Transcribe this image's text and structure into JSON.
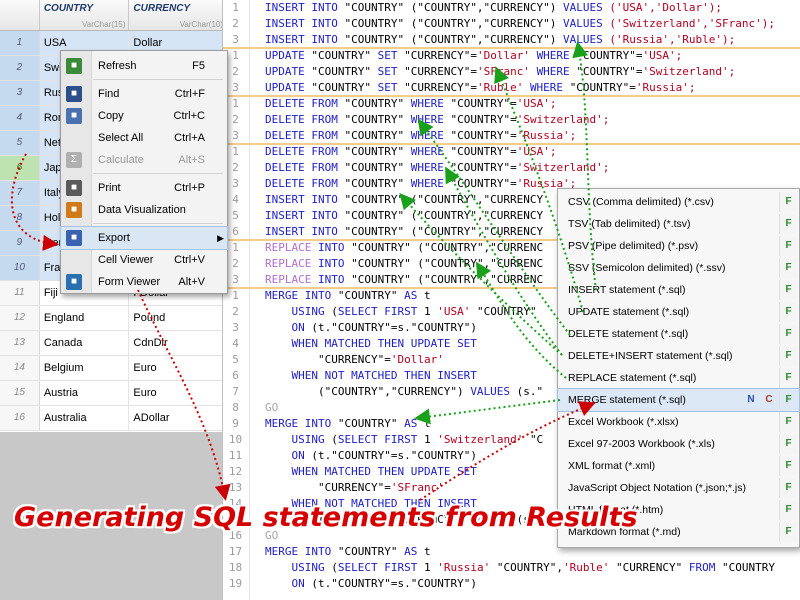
{
  "grid": {
    "columns": [
      {
        "name": "COUNTRY",
        "type": "VarChar(15)"
      },
      {
        "name": "CURRENCY",
        "type": "VarChar(10)"
      }
    ],
    "rows": [
      {
        "num": "1",
        "country": "USA",
        "currency": "Dollar"
      },
      {
        "num": "2",
        "country": "Swi",
        "currency": ""
      },
      {
        "num": "3",
        "country": "Rus",
        "currency": ""
      },
      {
        "num": "4",
        "country": "Ror",
        "currency": ""
      },
      {
        "num": "5",
        "country": "Net",
        "currency": ""
      },
      {
        "num": "6",
        "country": "Jap",
        "currency": ""
      },
      {
        "num": "7",
        "country": "Italy",
        "currency": ""
      },
      {
        "num": "8",
        "country": "Hol",
        "currency": ""
      },
      {
        "num": "9",
        "country": "Ger",
        "currency": ""
      },
      {
        "num": "10",
        "country": "Fra",
        "currency": ""
      },
      {
        "num": "11",
        "country": "Fiji",
        "currency": "FDollar"
      },
      {
        "num": "12",
        "country": "England",
        "currency": "Pound"
      },
      {
        "num": "13",
        "country": "Canada",
        "currency": "CdnDlr"
      },
      {
        "num": "14",
        "country": "Belgium",
        "currency": "Euro"
      },
      {
        "num": "15",
        "country": "Austria",
        "currency": "Euro"
      },
      {
        "num": "16",
        "country": "Australia",
        "currency": "ADollar"
      }
    ]
  },
  "context_menu": [
    {
      "label": "Refresh",
      "key": "F5",
      "icon": "refresh-icon",
      "color": "#3a8a3a"
    },
    {
      "label": "Find",
      "key": "Ctrl+F",
      "icon": "binoculars-icon",
      "color": "#2c4f8a"
    },
    {
      "label": "Copy",
      "key": "Ctrl+C",
      "icon": "copy-icon",
      "color": "#4a72b0"
    },
    {
      "label": "Select All",
      "key": "Ctrl+A",
      "icon": "",
      "color": ""
    },
    {
      "label": "Calculate",
      "key": "Alt+S",
      "icon": "sigma-icon",
      "color": "#b0b0b0",
      "disabled": true
    },
    {
      "label": "Print",
      "key": "Ctrl+P",
      "icon": "printer-icon",
      "color": "#5a5a5a"
    },
    {
      "label": "Data Visualization",
      "key": "",
      "icon": "chart-icon",
      "color": "#d07a1a"
    },
    {
      "label": "Export",
      "key": "",
      "icon": "export-icon",
      "color": "#3a62b0",
      "submenu": true
    },
    {
      "label": "Cell Viewer",
      "key": "Ctrl+V",
      "icon": "",
      "color": ""
    },
    {
      "label": "Form Viewer",
      "key": "Alt+V",
      "icon": "form-icon",
      "color": "#2a6fb0"
    }
  ],
  "export_menu": [
    {
      "label": "CSV (Comma delimited) (*.csv)",
      "badges": [
        "F"
      ]
    },
    {
      "label": "TSV (Tab delimited) (*.tsv)",
      "badges": [
        "F"
      ]
    },
    {
      "label": "PSV (Pipe delimited) (*.psv)",
      "badges": [
        "F"
      ]
    },
    {
      "label": "SSV (Semicolon delimited) (*.ssv)",
      "badges": [
        "F"
      ]
    },
    {
      "label": "INSERT statement (*.sql)",
      "badges": [
        "F"
      ]
    },
    {
      "label": "UPDATE statement (*.sql)",
      "badges": [
        "F"
      ]
    },
    {
      "label": "DELETE statement (*.sql)",
      "badges": [
        "F"
      ]
    },
    {
      "label": "DELETE+INSERT statement (*.sql)",
      "badges": [
        "F"
      ]
    },
    {
      "label": "REPLACE statement (*.sql)",
      "badges": [
        "F"
      ]
    },
    {
      "label": "MERGE statement (*.sql)",
      "badges": [
        "N",
        "C",
        "F"
      ],
      "active": true
    },
    {
      "label": "Excel Workbook (*.xlsx)",
      "badges": [
        "F"
      ]
    },
    {
      "label": "Excel 97-2003 Workbook (*.xls)",
      "badges": [
        "F"
      ]
    },
    {
      "label": "XML format (*.xml)",
      "badges": [
        "F"
      ]
    },
    {
      "label": "JavaScript Object Notation (*.json;*.js)",
      "badges": [
        "F"
      ]
    },
    {
      "label": "HTML format (*.htm)",
      "badges": [
        "F"
      ]
    },
    {
      "label": "Markdown format (*.md)",
      "badges": [
        "F"
      ]
    }
  ],
  "editor": {
    "lines": [
      {
        "n": "1",
        "t": [
          [
            "k",
            "INSERT INTO "
          ],
          [
            "p",
            "\"COUNTRY\" (\"COUNTRY\",\"CURRENCY\") "
          ],
          [
            "k",
            "VALUES "
          ],
          [
            "s",
            "('USA','Dollar');"
          ]
        ]
      },
      {
        "n": "2",
        "t": [
          [
            "k",
            "INSERT INTO "
          ],
          [
            "p",
            "\"COUNTRY\" (\"COUNTRY\",\"CURRENCY\") "
          ],
          [
            "k",
            "VALUES "
          ],
          [
            "s",
            "('Switzerland','SFranc');"
          ]
        ]
      },
      {
        "n": "3",
        "t": [
          [
            "k",
            "INSERT INTO "
          ],
          [
            "p",
            "\"COUNTRY\" (\"COUNTRY\",\"CURRENCY\") "
          ],
          [
            "k",
            "VALUES "
          ],
          [
            "s",
            "('Russia','Ruble');"
          ]
        ]
      },
      {
        "sep": true
      },
      {
        "n": "1",
        "t": [
          [
            "k",
            "UPDATE "
          ],
          [
            "p",
            "\"COUNTRY\" "
          ],
          [
            "k",
            "SET "
          ],
          [
            "p",
            "\"CURRENCY\"="
          ],
          [
            "s",
            "'Dollar' "
          ],
          [
            "k",
            "WHERE "
          ],
          [
            "p",
            "\"COUNTRY\"="
          ],
          [
            "s",
            "'USA';"
          ]
        ]
      },
      {
        "n": "2",
        "t": [
          [
            "k",
            "UPDATE "
          ],
          [
            "p",
            "\"COUNTRY\" "
          ],
          [
            "k",
            "SET "
          ],
          [
            "p",
            "\"CURRENCY\"="
          ],
          [
            "s",
            "'SFranc' "
          ],
          [
            "k",
            "WHERE "
          ],
          [
            "p",
            "\"COUNTRY\"="
          ],
          [
            "s",
            "'Switzerland';"
          ]
        ]
      },
      {
        "n": "3",
        "t": [
          [
            "k",
            "UPDATE "
          ],
          [
            "p",
            "\"COUNTRY\" "
          ],
          [
            "k",
            "SET "
          ],
          [
            "p",
            "\"CURRENCY\"="
          ],
          [
            "s",
            "'Ruble' "
          ],
          [
            "k",
            "WHERE "
          ],
          [
            "p",
            "\"COUNTRY\"="
          ],
          [
            "s",
            "'Russia';"
          ]
        ]
      },
      {
        "sep": true
      },
      {
        "n": "1",
        "t": [
          [
            "k",
            "DELETE FROM "
          ],
          [
            "p",
            "\"COUNTRY\" "
          ],
          [
            "k",
            "WHERE "
          ],
          [
            "p",
            "\"COUNTRY\"="
          ],
          [
            "s",
            "'USA';"
          ]
        ]
      },
      {
        "n": "2",
        "t": [
          [
            "k",
            "DELETE FROM "
          ],
          [
            "p",
            "\"COUNTRY\" "
          ],
          [
            "k",
            "WHERE "
          ],
          [
            "p",
            "\"COUNTRY\"="
          ],
          [
            "s",
            "'Switzerland';"
          ]
        ]
      },
      {
        "n": "3",
        "t": [
          [
            "k",
            "DELETE FROM "
          ],
          [
            "p",
            "\"COUNTRY\" "
          ],
          [
            "k",
            "WHERE "
          ],
          [
            "p",
            "\"COUNTRY\"="
          ],
          [
            "s",
            "'Russia';"
          ]
        ]
      },
      {
        "sep": true
      },
      {
        "n": "1",
        "t": [
          [
            "k",
            "DELETE FROM "
          ],
          [
            "p",
            "\"COUNTRY\" "
          ],
          [
            "k",
            "WHERE "
          ],
          [
            "p",
            "\"COUNTRY\"="
          ],
          [
            "s",
            "'USA';"
          ]
        ]
      },
      {
        "n": "2",
        "t": [
          [
            "k",
            "DELETE FROM "
          ],
          [
            "p",
            "\"COUNTRY\" "
          ],
          [
            "k",
            "WHERE "
          ],
          [
            "p",
            "\"COUNTRY\"="
          ],
          [
            "s",
            "'Switzerland';"
          ]
        ]
      },
      {
        "n": "3",
        "t": [
          [
            "k",
            "DELETE FROM "
          ],
          [
            "p",
            "\"COUNTRY\" "
          ],
          [
            "k",
            "WHERE "
          ],
          [
            "p",
            "\"COUNTRY\"="
          ],
          [
            "s",
            "'Russia';"
          ]
        ]
      },
      {
        "n": "4",
        "t": [
          [
            "k",
            "INSERT INTO "
          ],
          [
            "p",
            "\"COUNTRY\" (\"COUNTRY\",\"CURRENCY"
          ]
        ]
      },
      {
        "n": "5",
        "t": [
          [
            "k",
            "INSERT INTO "
          ],
          [
            "p",
            "\"COUNTRY\" (\"COUNTRY\",\"CURRENCY"
          ]
        ]
      },
      {
        "n": "6",
        "t": [
          [
            "k",
            "INSERT INTO "
          ],
          [
            "p",
            "\"COUNTRY\" (\"COUNTRY\",\"CURRENCY"
          ]
        ]
      },
      {
        "sep": true
      },
      {
        "n": "1",
        "t": [
          [
            "r",
            "REPLACE "
          ],
          [
            "k",
            "INTO "
          ],
          [
            "p",
            "\"COUNTRY\" (\"COUNTRY\",\"CURRENC"
          ]
        ]
      },
      {
        "n": "2",
        "t": [
          [
            "r",
            "REPLACE "
          ],
          [
            "k",
            "INTO "
          ],
          [
            "p",
            "\"COUNTRY\" (\"COUNTRY\",\"CURRENC"
          ]
        ]
      },
      {
        "n": "3",
        "t": [
          [
            "r",
            "REPLACE "
          ],
          [
            "k",
            "INTO "
          ],
          [
            "p",
            "\"COUNTRY\" (\"COUNTRY\",\"CURRENC"
          ]
        ]
      },
      {
        "sep": true
      },
      {
        "n": "1",
        "t": [
          [
            "k",
            "MERGE INTO "
          ],
          [
            "p",
            "\"COUNTRY\" "
          ],
          [
            "k",
            "AS "
          ],
          [
            "p",
            "t"
          ]
        ]
      },
      {
        "n": "2",
        "t": [
          [
            "p",
            "    "
          ],
          [
            "k",
            "USING "
          ],
          [
            "p",
            "("
          ],
          [
            "k",
            "SELECT FIRST "
          ],
          [
            "p",
            "1 "
          ],
          [
            "s",
            "'USA' "
          ],
          [
            "p",
            "\"COUNTRY\""
          ]
        ]
      },
      {
        "n": "3",
        "t": [
          [
            "p",
            "    "
          ],
          [
            "k",
            "ON "
          ],
          [
            "p",
            "(t.\"COUNTRY\"=s.\"COUNTRY\")"
          ]
        ]
      },
      {
        "n": "4",
        "t": [
          [
            "p",
            "    "
          ],
          [
            "k",
            "WHEN MATCHED THEN UPDATE SET"
          ]
        ]
      },
      {
        "n": "5",
        "t": [
          [
            "p",
            "        \"CURRENCY\"="
          ],
          [
            "s",
            "'Dollar'"
          ]
        ]
      },
      {
        "n": "6",
        "t": [
          [
            "p",
            "    "
          ],
          [
            "k",
            "WHEN NOT MATCHED THEN INSERT"
          ]
        ]
      },
      {
        "n": "7",
        "t": [
          [
            "p",
            "        (\"COUNTRY\",\"CURRENCY\") "
          ],
          [
            "k",
            "VALUES "
          ],
          [
            "p",
            "(s.\""
          ]
        ]
      },
      {
        "n": "8",
        "t": [
          [
            "g",
            "GO"
          ]
        ]
      },
      {
        "n": "9",
        "t": [
          [
            "k",
            "MERGE INTO "
          ],
          [
            "p",
            "\"COUNTRY\" "
          ],
          [
            "k",
            "AS "
          ],
          [
            "p",
            "t"
          ]
        ]
      },
      {
        "n": "10",
        "t": [
          [
            "p",
            "    "
          ],
          [
            "k",
            "USING "
          ],
          [
            "p",
            "("
          ],
          [
            "k",
            "SELECT FIRST "
          ],
          [
            "p",
            "1 "
          ],
          [
            "s",
            "'Switzerland' "
          ],
          [
            "p",
            "\"C"
          ]
        ]
      },
      {
        "n": "11",
        "t": [
          [
            "p",
            "    "
          ],
          [
            "k",
            "ON "
          ],
          [
            "p",
            "(t.\"COUNTRY\"=s.\"COUNTRY\")"
          ]
        ]
      },
      {
        "n": "12",
        "t": [
          [
            "p",
            "    "
          ],
          [
            "k",
            "WHEN MATCHED THEN UPDATE SET"
          ]
        ]
      },
      {
        "n": "13",
        "t": [
          [
            "p",
            "        \"CURRENCY\"="
          ],
          [
            "s",
            "'SFranc'"
          ]
        ]
      },
      {
        "n": "14",
        "t": [
          [
            "p",
            "    "
          ],
          [
            "k",
            "WHEN NOT MATCHED THEN INSERT"
          ]
        ]
      },
      {
        "n": "15",
        "t": [
          [
            "p",
            "        (\"COUNTRY\",\"CURRENCY\") "
          ],
          [
            "k",
            "VALUES "
          ],
          [
            "p",
            "(s.\""
          ]
        ]
      },
      {
        "n": "16",
        "t": [
          [
            "g",
            "GO"
          ]
        ]
      },
      {
        "n": "17",
        "t": [
          [
            "k",
            "MERGE INTO "
          ],
          [
            "p",
            "\"COUNTRY\" "
          ],
          [
            "k",
            "AS "
          ],
          [
            "p",
            "t"
          ]
        ]
      },
      {
        "n": "18",
        "t": [
          [
            "p",
            "    "
          ],
          [
            "k",
            "USING "
          ],
          [
            "p",
            "("
          ],
          [
            "k",
            "SELECT FIRST "
          ],
          [
            "p",
            "1 "
          ],
          [
            "s",
            "'Russia' "
          ],
          [
            "p",
            "\"COUNTRY\","
          ],
          [
            "s",
            "'Ruble' "
          ],
          [
            "p",
            "\"CURRENCY\" "
          ],
          [
            "k",
            "FROM "
          ],
          [
            "p",
            "\"COUNTRY"
          ]
        ]
      },
      {
        "n": "19",
        "t": [
          [
            "p",
            "    "
          ],
          [
            "k",
            "ON "
          ],
          [
            "p",
            "(t.\"COUNTRY\"=s.\"COUNTRY\")"
          ]
        ]
      }
    ]
  },
  "colors": {
    "keyword": "#2020c8",
    "string": "#b4001e",
    "replace": "#b070d0",
    "go": "#a8a8a8",
    "arrow_green": "#1aa01a",
    "arrow_red": "#cc0000",
    "title": "#d50000"
  },
  "banner": {
    "text": "Generating SQL statements from Results"
  }
}
